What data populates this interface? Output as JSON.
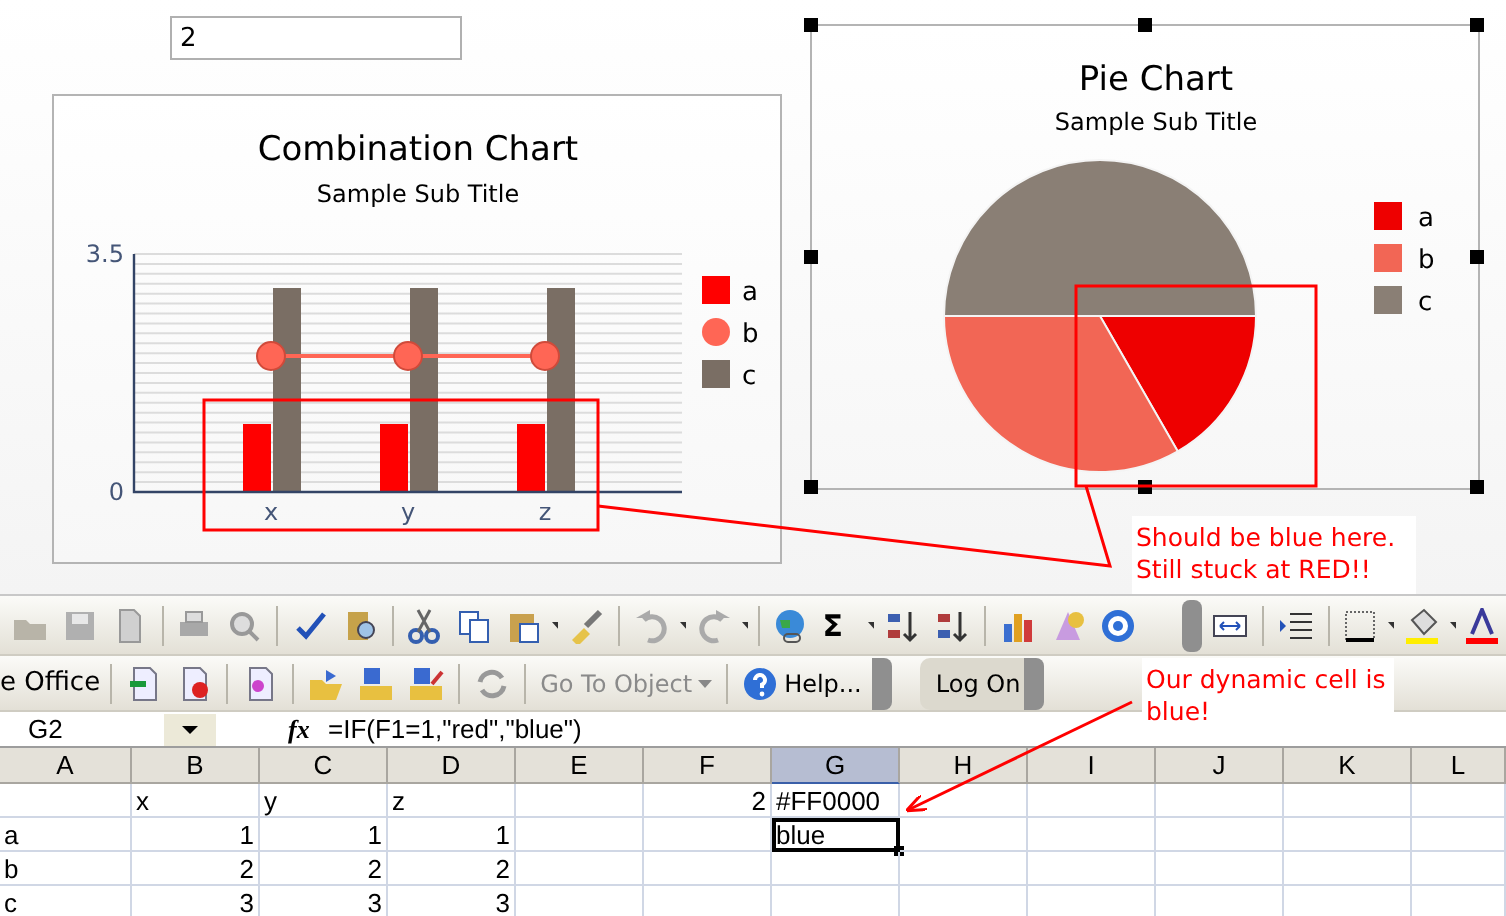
{
  "input_field": {
    "value": "2"
  },
  "combination_chart": {
    "title": "Combination Chart",
    "subtitle": "Sample Sub Title",
    "chart_data": {
      "type": "bar",
      "categories": [
        "x",
        "y",
        "z"
      ],
      "series": [
        {
          "name": "a",
          "type": "bar",
          "color": "#ff0000",
          "values": [
            1,
            1,
            1
          ]
        },
        {
          "name": "b",
          "type": "line",
          "marker": "circle",
          "color": "#ff6655",
          "values": [
            2,
            2,
            2
          ]
        },
        {
          "name": "c",
          "type": "bar",
          "color": "#7a6e64",
          "values": [
            3,
            3,
            3
          ]
        }
      ],
      "ylim": [
        0,
        3.5
      ],
      "yticks": [
        0,
        3.5
      ],
      "legend": "right"
    }
  },
  "pie_chart": {
    "title": "Pie Chart",
    "subtitle": "Sample Sub Title",
    "selected": true,
    "chart_data": {
      "type": "pie",
      "categories": [
        "a",
        "b",
        "c"
      ],
      "values": [
        16.7,
        33.3,
        50
      ],
      "colors": [
        "#ee0000",
        "#f26655",
        "#8a7f75"
      ],
      "legend": "right"
    }
  },
  "callouts": [
    {
      "lines": [
        "Should be blue here.",
        "Still stuck at RED!!"
      ]
    },
    {
      "lines": [
        "Our dynamic cell is",
        "blue!"
      ]
    }
  ],
  "toolbar_1": {
    "sum_glyph": "Σ"
  },
  "toolbar_2": {
    "items": [
      {
        "label": "e Office",
        "disabled": false
      },
      {
        "label": "Go To Object",
        "disabled": true
      },
      {
        "label": "Help...",
        "disabled": false
      },
      {
        "label": "Log On",
        "disabled": false
      }
    ]
  },
  "formula_bar": {
    "name_box": "G2",
    "fx": "fx",
    "formula": "=IF(F1=1,\"red\",\"blue\")"
  },
  "sheet": {
    "columns": [
      {
        "label": "A",
        "selected": false
      },
      {
        "label": "B",
        "selected": false
      },
      {
        "label": "C",
        "selected": false
      },
      {
        "label": "D",
        "selected": false
      },
      {
        "label": "E",
        "selected": false
      },
      {
        "label": "F",
        "selected": false
      },
      {
        "label": "G",
        "selected": true
      },
      {
        "label": "H",
        "selected": false
      },
      {
        "label": "I",
        "selected": false
      },
      {
        "label": "J",
        "selected": false
      },
      {
        "label": "K",
        "selected": false
      },
      {
        "label": "L",
        "selected": false
      }
    ],
    "rows": [
      {
        "cells": [
          {
            "selected": false
          },
          {
            "text": "x",
            "kind": "text",
            "selected": false
          },
          {
            "text": "y",
            "kind": "text",
            "selected": false
          },
          {
            "text": "z",
            "kind": "text",
            "selected": false
          },
          {
            "selected": false
          },
          {
            "text": "2",
            "kind": "number",
            "selected": false
          },
          {
            "text": "#FF0000",
            "kind": "text",
            "selected": false
          },
          {
            "selected": false
          },
          {
            "selected": false
          },
          {
            "selected": false
          },
          {
            "selected": false
          },
          {
            "selected": false
          }
        ]
      },
      {
        "cells": [
          {
            "text": "a",
            "kind": "text",
            "selected": false
          },
          {
            "text": "1",
            "kind": "number",
            "selected": false
          },
          {
            "text": "1",
            "kind": "number",
            "selected": false
          },
          {
            "text": "1",
            "kind": "number",
            "selected": false
          },
          {
            "selected": false
          },
          {
            "selected": false
          },
          {
            "text": "blue",
            "kind": "text",
            "selected": true
          },
          {
            "selected": false
          },
          {
            "selected": false
          },
          {
            "selected": false
          },
          {
            "selected": false
          },
          {
            "selected": false
          }
        ]
      },
      {
        "cells": [
          {
            "text": "b",
            "kind": "text",
            "selected": false
          },
          {
            "text": "2",
            "kind": "number",
            "selected": false
          },
          {
            "text": "2",
            "kind": "number",
            "selected": false
          },
          {
            "text": "2",
            "kind": "number",
            "selected": false
          },
          {
            "selected": false
          },
          {
            "selected": false
          },
          {
            "selected": false
          },
          {
            "selected": false
          },
          {
            "selected": false
          },
          {
            "selected": false
          },
          {
            "selected": false
          },
          {
            "selected": false
          }
        ]
      },
      {
        "cells": [
          {
            "text": "c",
            "kind": "text",
            "selected": false
          },
          {
            "text": "3",
            "kind": "number",
            "selected": false
          },
          {
            "text": "3",
            "kind": "number",
            "selected": false
          },
          {
            "text": "3",
            "kind": "number",
            "selected": false
          },
          {
            "selected": false
          },
          {
            "selected": false
          },
          {
            "selected": false
          },
          {
            "selected": false
          },
          {
            "selected": false
          },
          {
            "selected": false
          },
          {
            "selected": false
          },
          {
            "selected": false
          }
        ]
      }
    ]
  }
}
